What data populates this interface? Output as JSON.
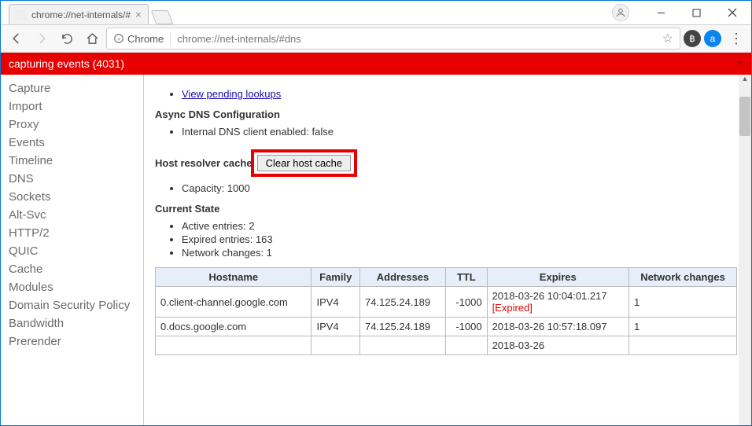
{
  "window": {
    "tab_title": "chrome://net-internals/#"
  },
  "toolbar": {
    "chip_label": "Chrome",
    "url": "chrome://net-internals/#dns"
  },
  "redbar": {
    "text": "capturing events (4031)"
  },
  "sidebar": {
    "items": [
      "Capture",
      "Import",
      "Proxy",
      "Events",
      "Timeline",
      "DNS",
      "Sockets",
      "Alt-Svc",
      "HTTP/2",
      "QUIC",
      "Cache",
      "Modules",
      "Domain Security Policy",
      "Bandwidth",
      "Prerender"
    ]
  },
  "main": {
    "pending_link": "View pending lookups",
    "async_header": "Async DNS Configuration",
    "async_item": "Internal DNS client enabled: false",
    "hrc_label": "Host resolver cache",
    "clear_btn": "Clear host cache",
    "capacity_item": "Capacity: 1000",
    "current_state_header": "Current State",
    "state_items": [
      "Active entries: 2",
      "Expired entries: 163",
      "Network changes: 1"
    ],
    "table": {
      "headers": [
        "Hostname",
        "Family",
        "Addresses",
        "TTL",
        "Expires",
        "Network changes"
      ],
      "rows": [
        {
          "host": "0.client-channel.google.com",
          "family": "IPV4",
          "addr": "74.125.24.189",
          "ttl": "-1000",
          "expires": "2018-03-26 10:04:01.217",
          "expired": true,
          "net": "1"
        },
        {
          "host": "0.docs.google.com",
          "family": "IPV4",
          "addr": "74.125.24.189",
          "ttl": "-1000",
          "expires": "2018-03-26 10:57:18.097",
          "expired": false,
          "net": "1"
        }
      ],
      "partial": {
        "expires": "2018-03-26"
      }
    }
  }
}
